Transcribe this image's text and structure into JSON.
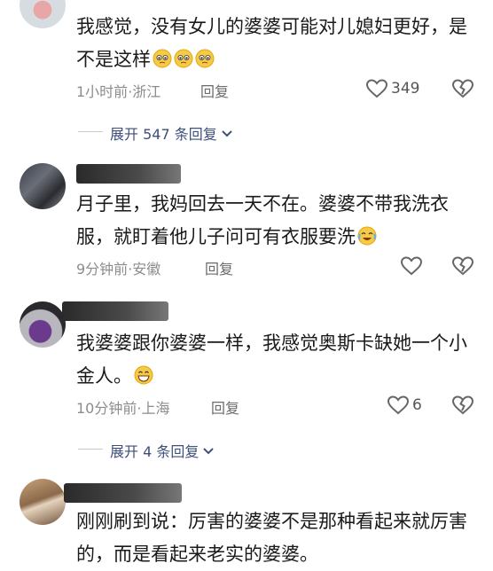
{
  "comments": [
    {
      "text_line1": "我感觉，没有女儿的婆婆可能对儿媳妇更好，是",
      "text_line2": "不是这样",
      "emoji": "pleading-face-emoji",
      "emoji_count": 3,
      "time": "1小时前",
      "location": "浙江",
      "reply_label": "回复",
      "likes": "349"
    },
    {
      "text_line1": "月子里，我妈回去一天不在。婆婆不带我洗衣",
      "text_line2": "服，就盯着他儿子问可有衣服要洗",
      "emoji": "crying-laughing-emoji",
      "time": "9分钟前",
      "location": "安徽",
      "reply_label": "回复"
    },
    {
      "text_line1": "我婆婆跟你婆婆一样，我感觉奥斯卡缺她一个小",
      "text_line2": "金人。",
      "emoji": "grinning-emoji",
      "time": "10分钟前",
      "location": "上海",
      "reply_label": "回复",
      "likes": "6"
    },
    {
      "text_line1": "刚刚刷到说：厉害的婆婆不是那种看起来就厉害",
      "text_line2": "的，而是看起来老实的婆婆。"
    }
  ],
  "expand_replies": [
    {
      "label": "展开 547 条回复"
    },
    {
      "label": "展开 4 条回复"
    }
  ],
  "dot": "·"
}
